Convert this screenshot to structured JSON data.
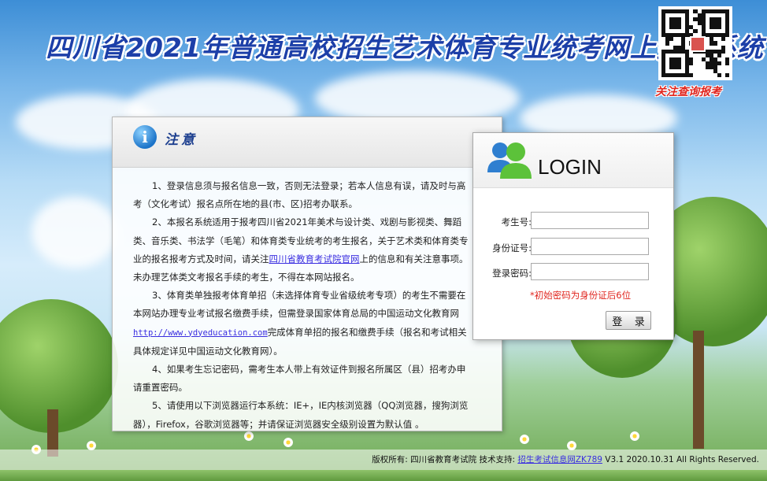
{
  "header": {
    "title": "四川省2021年普通高校招生艺术体育专业统考网上报名系统",
    "qr_caption": "关注查询报考"
  },
  "notice": {
    "icon": "info-icon",
    "title": "注意",
    "items": [
      {
        "text_a": "1、登录信息须与报名信息一致，否则无法登录；若本人信息有误，请及时与高考（文化考试）报名点所在地的县(市、区)招考办联系。"
      },
      {
        "text_a": "2、本报名系统适用于报考四川省2021年美术与设计类、戏剧与影视类、舞蹈类、音乐类、书法学（毛笔）和体育类专业统考的考生报名，关于艺术类和体育类专业的报名报考方式及时间，请关注",
        "link": "四川省教育考试院官网",
        "text_b": "上的信息和有关注意事项。未办理艺体类文考报名手续的考生，不得在本网站报名。"
      },
      {
        "text_a": "3、体育类单独报考体育单招（未选择体育专业省级统考专项）的考生不需要在本网站办理专业考试报名缴费手续，但需登录国家体育总局的中国运动文化教育网",
        "link": "http://www.ydyeducation.com",
        "text_b": "完成体育单招的报名和缴费手续（报名和考试相关具体规定详见中国运动文化教育网）。"
      },
      {
        "text_a": "4、如果考生忘记密码，需考生本人带上有效证件到报名所属区（县）招考办申请重置密码。"
      },
      {
        "text_a": "5、请使用以下浏览器运行本系统：IE+，IE内核浏览器（QQ浏览器，搜狗浏览器），Firefox，谷歌浏览器等；并请保证浏览器安全级别设置为默认值 。"
      }
    ]
  },
  "login": {
    "icon": "users-icon",
    "title": "LOGIN",
    "fields": [
      {
        "label": "考生号:",
        "value": ""
      },
      {
        "label": "身份证号:",
        "value": ""
      },
      {
        "label": "登录密码:",
        "value": ""
      }
    ],
    "hint": "*初始密码为身份证后6位",
    "button": "登 录"
  },
  "footer": {
    "text_a": "版权所有: 四川省教育考试院 技术支持: ",
    "link": "招生考试信息网ZK789",
    "text_b": " V3.1 2020.10.31 All Rights Reserved."
  },
  "colors": {
    "title_blue": "#1c3fa8",
    "hint_red": "#e0261f",
    "link_blue": "#3a2ee0"
  }
}
